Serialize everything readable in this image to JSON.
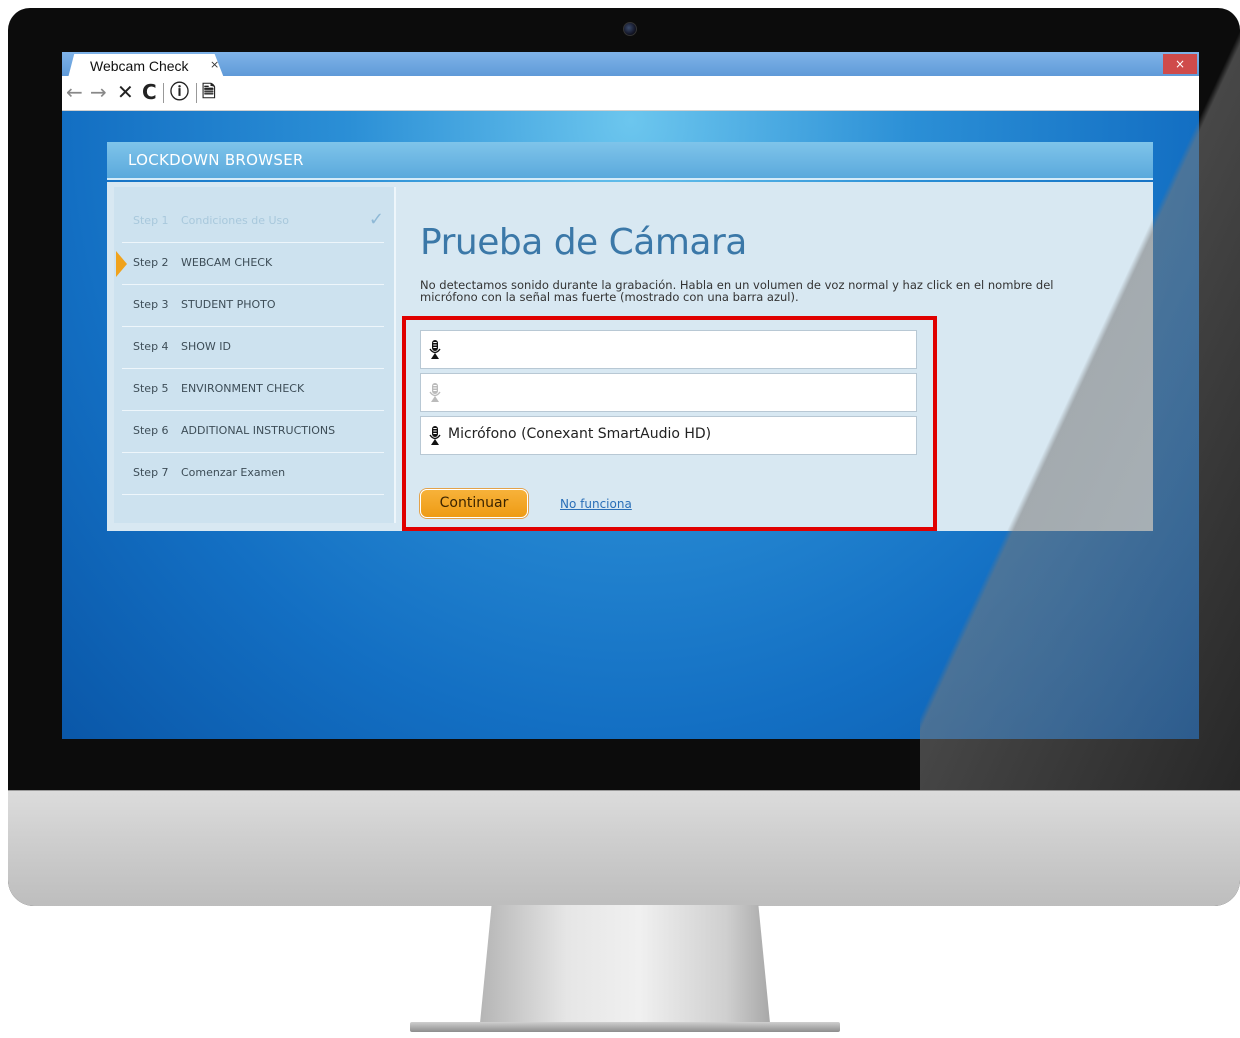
{
  "browser": {
    "tab_title": "Webcam Check",
    "tab_close": "×",
    "window_close": "×",
    "toolbar": {
      "back_icon": "←",
      "forward_icon": "→",
      "stop_icon": "✕",
      "reload_icon": "C",
      "info_icon": "ⓘ",
      "reader_icon": "🗎"
    }
  },
  "app": {
    "header_title": "LOCKDOWN BROWSER",
    "steps": [
      {
        "num": "Step 1",
        "label": "Condiciones de Uso",
        "state": "done"
      },
      {
        "num": "Step 2",
        "label": "WEBCAM CHECK",
        "state": "current"
      },
      {
        "num": "Step 3",
        "label": "STUDENT PHOTO",
        "state": "pending"
      },
      {
        "num": "Step 4",
        "label": "SHOW ID",
        "state": "pending"
      },
      {
        "num": "Step 5",
        "label": "ENVIRONMENT CHECK",
        "state": "pending"
      },
      {
        "num": "Step 6",
        "label": "ADDITIONAL INSTRUCTIONS",
        "state": "pending"
      },
      {
        "num": "Step 7",
        "label": "Comenzar Examen",
        "state": "pending"
      }
    ],
    "check_mark": "✓",
    "main": {
      "title": "Prueba de Cámara",
      "instructions_line1": "No detectamos sonido durante la grabación. Habla en un volumen de voz normal y haz click en el nombre del",
      "instructions_line2": "micrófono con la señal mas fuerte (mostrado con una barra azul).",
      "microphones": [
        {
          "label": "",
          "icon": "microphone-icon",
          "icon_color": "#111111"
        },
        {
          "label": "",
          "icon": "microphone-icon",
          "icon_color": "#bbbbbb"
        },
        {
          "label": "Micrófono (Conexant SmartAudio HD)",
          "icon": "microphone-icon",
          "icon_color": "#111111"
        }
      ],
      "continue_button": "Continuar",
      "not_working_link": "No funciona"
    }
  },
  "colors": {
    "accent_orange": "#f0a21c",
    "highlight_red": "#e00000",
    "link_blue": "#2a6fb8"
  }
}
